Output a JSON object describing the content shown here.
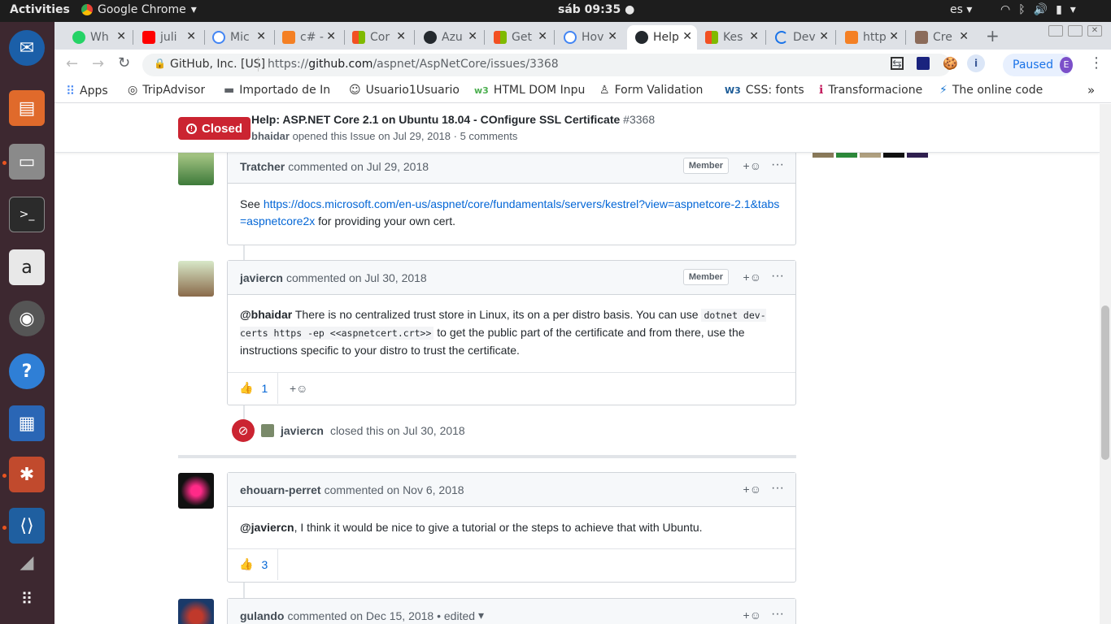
{
  "system": {
    "activities": "Activities",
    "app_name": "Google Chrome",
    "clock": "sáb 09:35",
    "lang": "es"
  },
  "tabs": [
    {
      "label": "Wh",
      "color": "#25d366",
      "icon": "whatsapp-icon"
    },
    {
      "label": "juli",
      "color": "#ff0000",
      "icon": "youtube-icon"
    },
    {
      "label": "Mic",
      "color": "#4285f4",
      "icon": "google-icon"
    },
    {
      "label": "c# -",
      "color": "#f48024",
      "icon": "stackoverflow-icon"
    },
    {
      "label": "Cor",
      "color": "#f25022",
      "icon": "microsoft-icon"
    },
    {
      "label": "Azu",
      "color": "#24292e",
      "icon": "github-icon"
    },
    {
      "label": "Get",
      "color": "#f25022",
      "icon": "microsoft-icon"
    },
    {
      "label": "Hov",
      "color": "#4285f4",
      "icon": "google-icon"
    },
    {
      "label": "Help",
      "color": "#24292e",
      "icon": "github-icon"
    },
    {
      "label": "Kes",
      "color": "#f25022",
      "icon": "microsoft-icon"
    },
    {
      "label": "Dev",
      "color": "#1a73e8",
      "icon": "loading-icon"
    },
    {
      "label": "http",
      "color": "#f48024",
      "icon": "stackoverflow-icon"
    },
    {
      "label": "Cre",
      "color": "#8b6b5a",
      "icon": "avatar-icon"
    }
  ],
  "omnibox": {
    "site": "GitHub, Inc. [US]",
    "url_prefix": "https://",
    "url_host": "github.com",
    "url_path": "/aspnet/AspNetCore/issues/3368",
    "profile_label": "Paused",
    "profile_initial": "E"
  },
  "bookmarks": [
    {
      "label": "Apps",
      "icon": "apps-grid-icon"
    },
    {
      "label": "TripAdvisor",
      "icon": "tripadvisor-icon"
    },
    {
      "label": "Importado de In",
      "icon": "folder-icon"
    },
    {
      "label": "Usuario1Usuario",
      "icon": "smiley-icon"
    },
    {
      "label": "HTML DOM Inpu",
      "icon": "w3-icon"
    },
    {
      "label": "Form Validation",
      "icon": "linux-icon"
    },
    {
      "label": "CSS: fonts",
      "icon": "w3c-icon"
    },
    {
      "label": "Transformacione",
      "icon": "info-icon"
    },
    {
      "label": "The online code",
      "icon": "bolt-icon"
    }
  ],
  "issue": {
    "status": "Closed",
    "title": "Help: ASP.NET Core 2.1 on Ubuntu 18.04 - COnfigure SSL Certificate",
    "number": "#3368",
    "author": "bhaidar",
    "meta": "opened this Issue on Jul 29, 2018 · 5 comments"
  },
  "comments": [
    {
      "author": "Tratcher",
      "action": "commented on Jul 29, 2018",
      "badge": "Member",
      "body_prefix": "See ",
      "link": "https://docs.microsoft.com/en-us/aspnet/core/fundamentals/servers/kestrel?view=aspnetcore-2.1&tabs=aspnetcore2x",
      "body_suffix": " for providing your own cert."
    },
    {
      "author": "javiercn",
      "action": "commented on Jul 30, 2018",
      "badge": "Member",
      "mention": "@bhaidar",
      "text1": " There is no centralized trust store in Linux, its on a per distro basis. You can use ",
      "code1": "dotnet dev-certs https -ep <<aspnetcert.crt>>",
      "text2": " to get the public part of the certificate and from there, use the instructions specific to your distro to trust the certificate.",
      "thumbs": "1"
    },
    {
      "author": "ehouarn-perret",
      "action": "commented on Nov 6, 2018",
      "mention": "@javiercn",
      "text1": ", I think it would be nice to give a tutorial or the steps to achieve that with Ubuntu.",
      "thumbs": "3"
    },
    {
      "author": "gulando",
      "action": "commented on Dec 15, 2018 • edited"
    }
  ],
  "event": {
    "actor": "javiercn",
    "text": "closed this on Jul 30, 2018"
  }
}
